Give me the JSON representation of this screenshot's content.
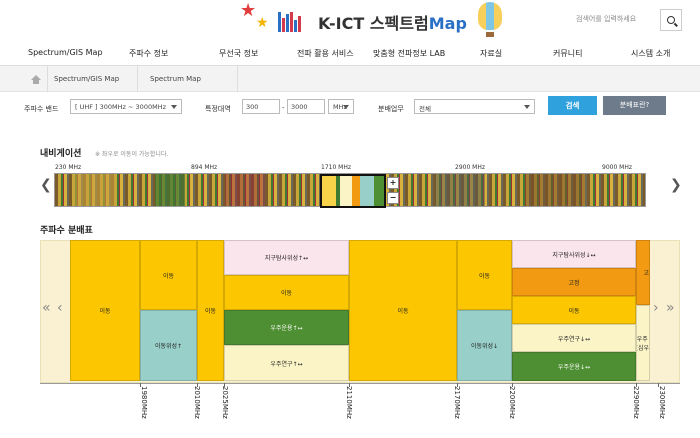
{
  "header": {
    "logo_text": "K-ICT 스펙트럼",
    "logo_map": "Map",
    "search_placeholder": "검색어를 입력하세요"
  },
  "gnb": [
    "Spectrum/GIS Map",
    "주파수 정보",
    "무선국 정보",
    "전파 활용 서비스",
    "맞춤형 전파정보 LAB",
    "자료실",
    "커뮤니티",
    "시스템 소개"
  ],
  "breadcrumb": {
    "level1": "Spectrum/GIS Map",
    "level2": "Spectrum Map"
  },
  "filters": {
    "band_label": "주파수 밴드",
    "band_value": "[ UHF ]   300MHz ~ 3000MHz",
    "range_label": "특정대역",
    "range_from": "300",
    "range_sep": "-",
    "range_to": "3000",
    "unit": "MHz",
    "service_label": "분배업무",
    "service_value": "전체",
    "search_button": "검색",
    "help_button": "분배표란?"
  },
  "navigation": {
    "title": "내비게이션",
    "hint": "※ 좌우로 이동이 가능합니다.",
    "ticks": [
      "230 MHz",
      "894 MHz",
      "1710 MHz",
      "2900 MHz",
      "9000 MHz"
    ],
    "zoom_in": "+",
    "zoom_out": "−"
  },
  "allocation": {
    "title": "주파수 분배표",
    "cells": {
      "c1": "이동",
      "c2a": "이동",
      "c2b": "이동위성↑",
      "c3": "이동",
      "c4a": "지구탐사위성↑↔",
      "c4b": "이동",
      "c4c": "우주운용↑↔",
      "c4d": "우주연구↑↔",
      "c5": "이동",
      "c6a": "이동",
      "c6b": "이동위성↓",
      "c7a": "지구탐사위성↓↔",
      "c7b": "고정",
      "c7c": "이동",
      "c7d": "우주연구↓↔",
      "c7e": "우주운용↓↔",
      "c8a": "고",
      "c8b": "우주\n(심우"
    },
    "freqs": [
      "1980MHz",
      "2010MHz",
      "2025MHz",
      "2110MHz",
      "2170MHz",
      "2200MHz",
      "2290MHz",
      "2300MHz"
    ]
  },
  "colors": {
    "mobile": "#fcc700",
    "mobile_sat": "#98cfc8",
    "earth_explore": "#fbe5ec",
    "space_op": "#4f8f34",
    "space_research": "#fbf4c7",
    "fixed": "#f29b12",
    "accent": "#2fa1dc"
  }
}
